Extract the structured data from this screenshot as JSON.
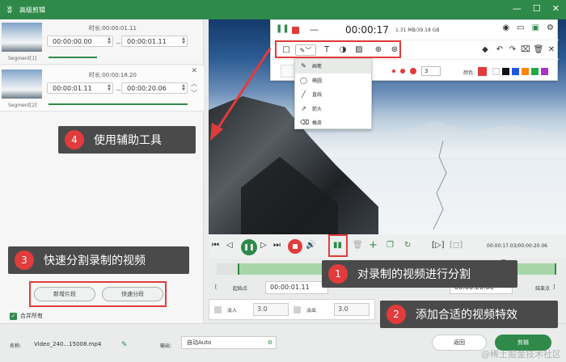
{
  "titlebar": {
    "title": "高级剪辑",
    "logo": "ʬ",
    "minimize": "—",
    "maximize": "☐",
    "close": "✕"
  },
  "segments": [
    {
      "label": "Segment[1]",
      "duration_label": "时长:",
      "duration": "00:00:01.11",
      "start": "00:00:00.00",
      "end": "00:00:01.11"
    },
    {
      "label": "Segment[2]",
      "duration_label": "时长:",
      "duration": "00:00:18.20",
      "start": "00:00:01.11",
      "end": "00:00:20.06"
    }
  ],
  "left_buttons": {
    "new_segment": "新增片段",
    "quick_split": "快速分段"
  },
  "merge_all": "合并所有",
  "recorder": {
    "time": "00:00:17",
    "size": "1.31 MB/39.18 GB",
    "pen_width": "3",
    "color_label": "颜色:",
    "colors": [
      "#e23b3b",
      "#ffffff",
      "#111111",
      "#2255dd",
      "#ff8800",
      "#22aa44",
      "#aa33cc"
    ]
  },
  "pen_menu": [
    {
      "icon": "✎",
      "label": "画笔"
    },
    {
      "icon": "◯",
      "label": "椭圆"
    },
    {
      "icon": "╱",
      "label": "直线"
    },
    {
      "icon": "↗",
      "label": "箭头"
    },
    {
      "icon": "⌫",
      "label": "橡皮"
    }
  ],
  "playback": {
    "current_total": "00:00:17.03/00:00:20.06"
  },
  "inout": {
    "start_label": "起始点",
    "start_time": "00:00:01.11",
    "end_time": "00:00:20.06",
    "end_label": "结束点"
  },
  "effects": {
    "fade_in_label": "淡入",
    "fade_in": "3.0",
    "fade_out_label": "淡出",
    "fade_out": "3.0"
  },
  "bottom": {
    "name_label": "名称:",
    "name_value": "Video_240...15008.mp4",
    "output_label": "输出:",
    "output_value": "自动Auto",
    "back_button": "返回",
    "cut_button": "剪辑"
  },
  "callouts": [
    {
      "num": "1",
      "text": "对录制的视频进行分割"
    },
    {
      "num": "2",
      "text": "添加合适的视频特效"
    },
    {
      "num": "3",
      "text": "快速分割录制的视频"
    },
    {
      "num": "4",
      "text": "使用辅助工具"
    }
  ],
  "watermark": "@稀土掘金技术社区",
  "accent": "#2f8a4a",
  "highlight": "#e23b3b"
}
